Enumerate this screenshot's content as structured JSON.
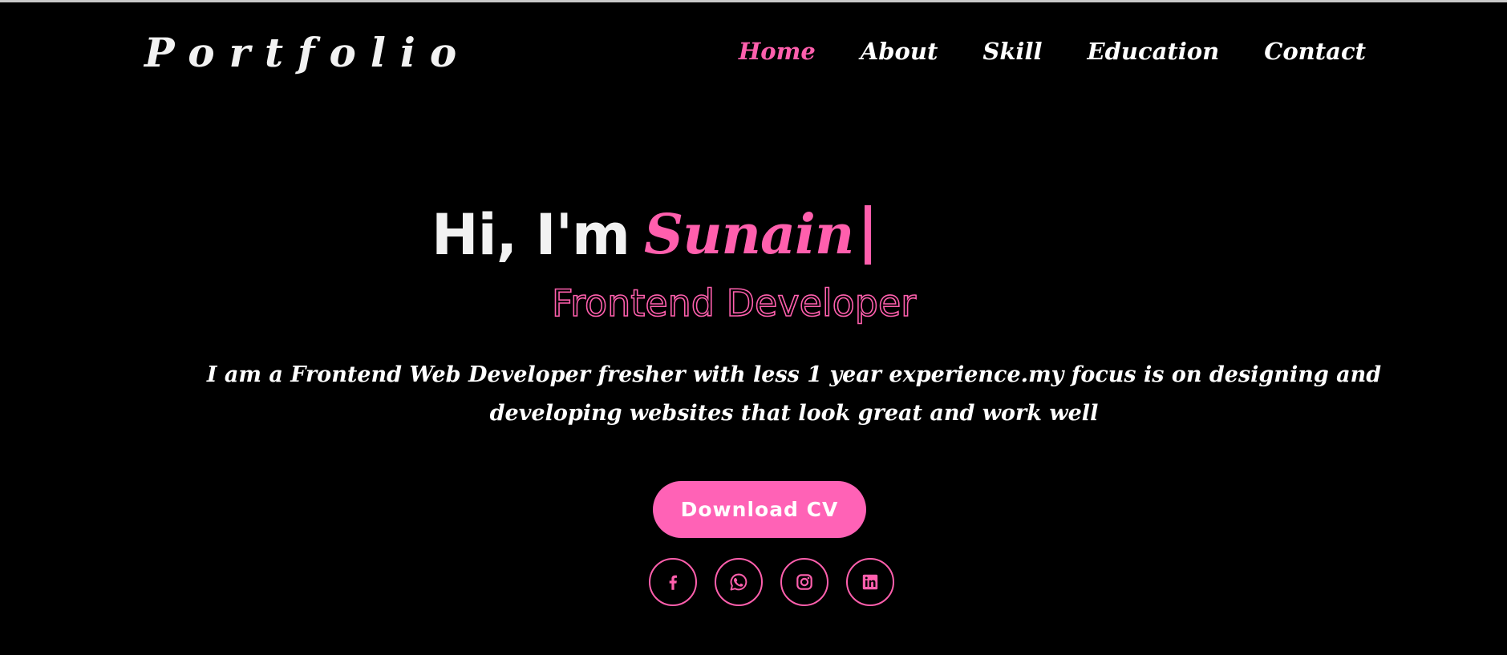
{
  "brand": "Portfolio",
  "nav": {
    "items": [
      {
        "label": "Home",
        "active": true
      },
      {
        "label": "About",
        "active": false
      },
      {
        "label": "Skill",
        "active": false
      },
      {
        "label": "Education",
        "active": false
      },
      {
        "label": "Contact",
        "active": false
      }
    ]
  },
  "hero": {
    "greeting": "Hi, I'm",
    "name": "Sunain",
    "role": "Frontend Developer",
    "about": "I am a Frontend Web Developer fresher with less 1 year experience.my focus is on designing and developing websites that look great and work well",
    "cta_label": "Download CV"
  },
  "socials": [
    {
      "icon": "facebook-icon"
    },
    {
      "icon": "whatsapp-icon"
    },
    {
      "icon": "instagram-icon"
    },
    {
      "icon": "linkedin-icon"
    }
  ],
  "colors": {
    "background": "#000000",
    "accent": "#ff5fad",
    "text": "#ffffff"
  }
}
